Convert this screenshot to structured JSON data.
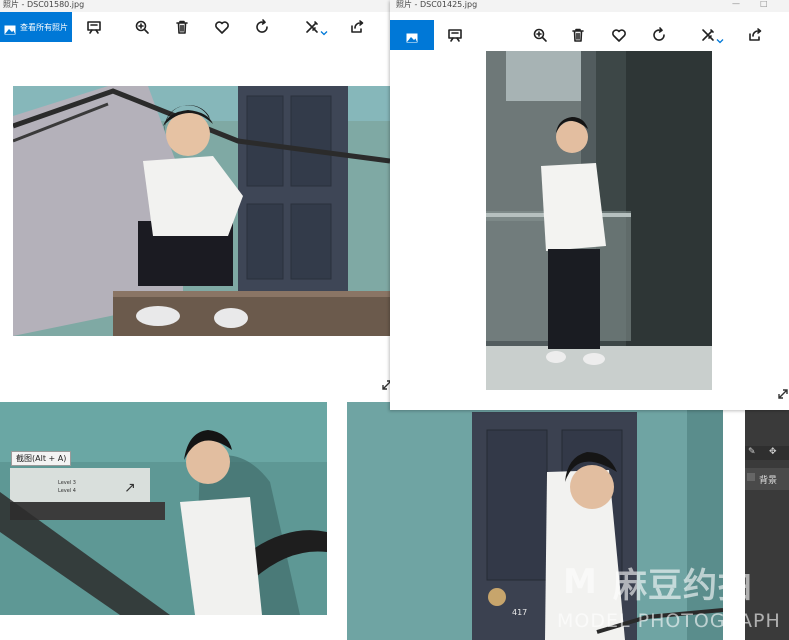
{
  "left_window": {
    "title": "照片 - DSC01580.jpg",
    "view_all_label": "查看所有照片"
  },
  "right_window": {
    "title": "照片 - DSC01425.jpg"
  },
  "window_controls": {
    "minimize": "—",
    "maximize": "□"
  },
  "toolbar_icons": [
    "view-all-icon",
    "slideshow-icon",
    "zoom-icon",
    "delete-icon",
    "favorite-icon",
    "rotate-icon",
    "edit-icon",
    "share-icon"
  ],
  "tooltip": {
    "text": "截图(Alt + A)"
  },
  "sign": {
    "line1": "Level 3",
    "line2": "Level 4"
  },
  "door_number": "417",
  "photoshop_panel": {
    "layer_label": "背景"
  },
  "watermark": {
    "brand_cn": "麻豆约拍",
    "brand_en": "MODEL PHOTOGRAPH"
  },
  "colors": {
    "accent": "#0078d7",
    "teal_wall": "#6fa2a0",
    "ps_dark": "#3a3a3a"
  }
}
